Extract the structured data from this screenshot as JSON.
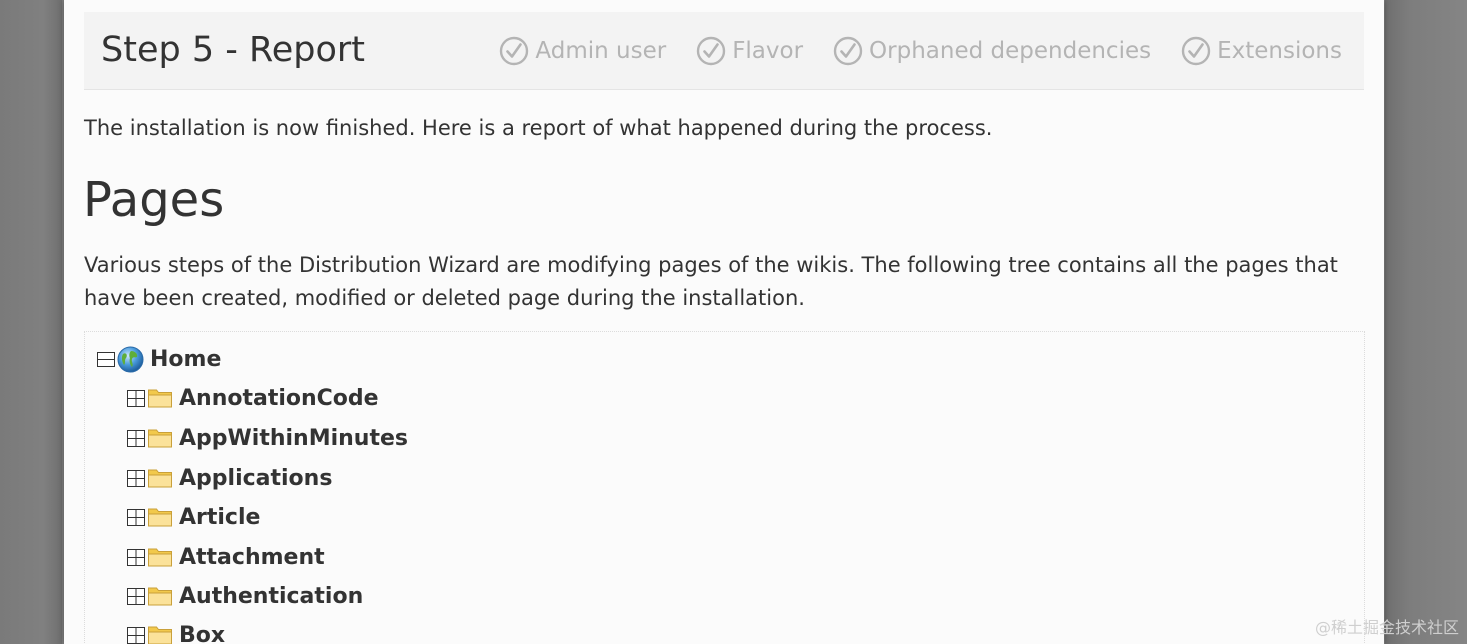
{
  "header": {
    "title": "Step 5 - Report",
    "steps": [
      {
        "label": "Admin user",
        "icon": "check-circle-icon"
      },
      {
        "label": "Flavor",
        "icon": "check-circle-icon"
      },
      {
        "label": "Orphaned dependencies",
        "icon": "check-circle-icon"
      },
      {
        "label": "Extensions",
        "icon": "check-circle-icon"
      }
    ]
  },
  "intro": "The installation is now finished. Here is a report of what happened during the process.",
  "pages_section": {
    "heading": "Pages",
    "description": "Various steps of the Distribution Wizard are modifying pages of the wikis. The following tree contains all the pages that have been created, modified or deleted page during the installation."
  },
  "tree": {
    "root": {
      "label": "Home",
      "icon": "globe-icon",
      "expanded": true
    },
    "children": [
      {
        "label": "AnnotationCode",
        "icon": "folder-icon",
        "expanded": false
      },
      {
        "label": "AppWithinMinutes",
        "icon": "folder-icon",
        "expanded": false
      },
      {
        "label": "Applications",
        "icon": "folder-icon",
        "expanded": false
      },
      {
        "label": "Article",
        "icon": "folder-icon",
        "expanded": false
      },
      {
        "label": "Attachment",
        "icon": "folder-icon",
        "expanded": false
      },
      {
        "label": "Authentication",
        "icon": "folder-icon",
        "expanded": false
      },
      {
        "label": "Box",
        "icon": "folder-icon",
        "expanded": false
      }
    ]
  },
  "watermark": "@稀土掘金技术社区",
  "colors": {
    "step_inactive": "#b4b4b4",
    "text": "#333333",
    "panel_bg": "#fbfbfb",
    "backdrop": "#7f7f7f"
  }
}
